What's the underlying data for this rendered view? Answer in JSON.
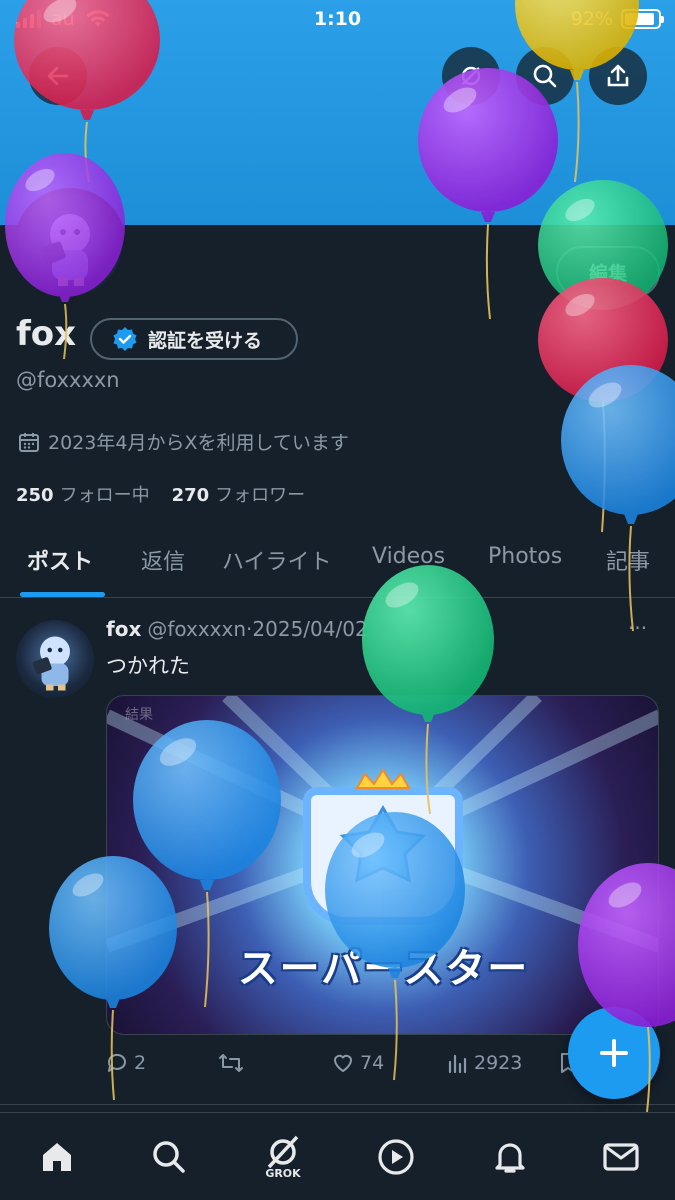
{
  "status_bar": {
    "carrier": "au",
    "time": "1:10",
    "battery_percent": "92%",
    "battery_level": 0.92
  },
  "header": {
    "back_icon": "arrow-left-icon",
    "grok_icon": "grok-icon",
    "search_icon": "search-icon",
    "share_icon": "share-icon"
  },
  "profile": {
    "display_name": "fox",
    "verify_label": "認証を受ける",
    "edit_label": "編集",
    "handle": "@foxxxxn",
    "joined": "2023年4月からXを利用しています",
    "following_count": "250",
    "following_label": "フォロー中",
    "followers_count": "270",
    "followers_label": "フォロワー"
  },
  "tabs": [
    {
      "label": "ポスト",
      "active": true
    },
    {
      "label": "返信"
    },
    {
      "label": "ハイライト"
    },
    {
      "label": "Videos"
    },
    {
      "label": "Photos"
    },
    {
      "label": "記事"
    }
  ],
  "post": {
    "name": "fox",
    "handle": "@foxxxxn",
    "date": "2025/04/02",
    "dot": "·",
    "more": "···",
    "text": "つかれた",
    "image_caption": "スーパースター",
    "image_top_text": "結果",
    "replies": "2",
    "likes": "74",
    "views": "2923"
  },
  "fab": {
    "icon": "plus-icon"
  },
  "bottom_nav": {
    "grok_label": "GROK"
  },
  "colors": {
    "background": "#15202b",
    "banner": "#1d9bf0",
    "accent": "#1d9bf0",
    "text_primary": "#e7e9ea",
    "text_secondary": "#8b98a5",
    "border": "#38444d"
  }
}
